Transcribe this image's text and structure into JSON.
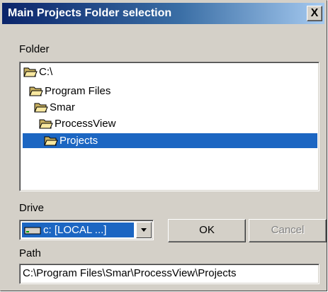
{
  "window": {
    "title": "Main Projects Folder selection",
    "close_glyph": "X"
  },
  "folder_section": {
    "label": "Folder",
    "items": [
      {
        "label": "C:\\",
        "icon": "open-folder-icon"
      },
      {
        "label": "Program Files",
        "icon": "open-folder-icon"
      },
      {
        "label": "Smar",
        "icon": "open-folder-icon"
      },
      {
        "label": "ProcessView",
        "icon": "open-folder-icon"
      },
      {
        "label": "Projects",
        "icon": "open-folder-icon",
        "selected": true
      }
    ]
  },
  "drive_section": {
    "label": "Drive",
    "selected_value": "c: [LOCAL ...]",
    "icon": "hard-drive-icon"
  },
  "buttons": {
    "ok_label": "OK",
    "cancel_label": "Cancel"
  },
  "path_section": {
    "label": "Path",
    "value": "C:\\Program Files\\Smar\\ProcessView\\Projects"
  },
  "colors": {
    "title_gradient_start": "#0a246a",
    "title_gradient_end": "#a6caf0",
    "selection": "#1c66c2",
    "dialog_face": "#d4d0c8"
  }
}
